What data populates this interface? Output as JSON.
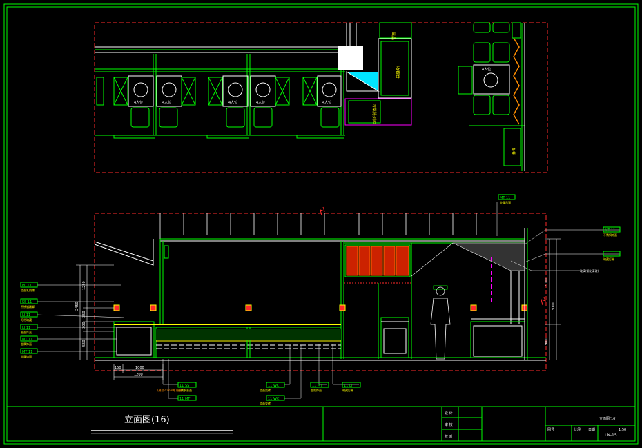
{
  "title_block": {
    "drawing_title": "立面图(16)",
    "sheet_no": "LN-15",
    "drawing_name": "立面图(16)",
    "row_labels": [
      "设 计",
      "审 核",
      "校 对"
    ],
    "bottom_cells": [
      "图号",
      "比例",
      "日期"
    ],
    "scale": "1:50"
  },
  "plan": {
    "table_labels": [
      "4人位",
      "4人位",
      "4人位",
      "4人位",
      "4人位",
      "4人位"
    ],
    "counter_label": "收银台",
    "service_label": "冷菜陈列柜",
    "room_label": "备餐",
    "top_label": "出品",
    "right_table_label": "4人位"
  },
  "tags": {
    "left": [
      {
        "code": "PL 11",
        "sub": "墙面乳胶漆"
      },
      {
        "code": "SS 11",
        "sub": "不锈钢踢脚"
      },
      {
        "code": "LI 11",
        "sub": "灯带暗藏"
      },
      {
        "code": "LI 11",
        "sub": "台面灯光"
      },
      {
        "code": "MT 11",
        "sub": "金属饰面"
      },
      {
        "code": "MT 11",
        "sub": "金属饰面"
      }
    ],
    "top": {
      "code": "MT 11",
      "sub": "金属吊顶"
    },
    "right": [
      {
        "code": "MT 11",
        "sub": "不锈钢饰面"
      },
      {
        "code": "LI 11",
        "sub": "暗藏灯带"
      }
    ],
    "right_note": "玻璃(钢化清玻)",
    "bottom": [
      {
        "code": "11 SS",
        "sub": "不锈钢台面"
      },
      {
        "code": "11 MT",
        "sub": ""
      },
      {
        "code": "11 WC",
        "sub": "墙面瓷砖"
      },
      {
        "code": "11 WC",
        "sub": "墙面瓷砖"
      },
      {
        "code": "11 MT",
        "sub": "金属饰面"
      },
      {
        "code": "11 LI",
        "sub": "暗藏灯带"
      }
    ],
    "bottom_left_note": "(建议20mm厚)台面"
  },
  "dimensions": {
    "left_total": "2450",
    "left_parts": [
      "1250",
      "350",
      "300",
      "550"
    ],
    "bottom_parts": [
      "150",
      "1000",
      "1200"
    ],
    "right_total": "3000",
    "right_parts": [
      "2100",
      "900"
    ]
  },
  "colors": {
    "frame": "#00ff00",
    "red": "#ff2a2a",
    "cyan": "#00e5ff",
    "yellow": "#ffff00",
    "white": "#ffffff",
    "magenta": "#ff00ff",
    "orange": "#ff8c00"
  }
}
